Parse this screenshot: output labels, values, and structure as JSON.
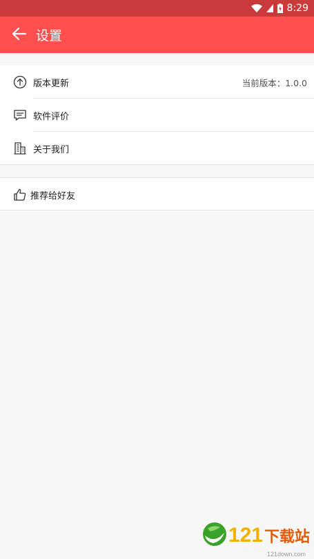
{
  "status_bar": {
    "time": "8:29",
    "icons": [
      "wifi-icon",
      "signal-icon",
      "battery-charging-icon"
    ]
  },
  "app_bar": {
    "title": "设置",
    "back_icon": "arrow-left-icon"
  },
  "settings_group_1": [
    {
      "icon": "upload-circle-icon",
      "label": "版本更新",
      "value": "当前版本：1.0.0"
    },
    {
      "icon": "comment-icon",
      "label": "软件评价"
    },
    {
      "icon": "building-icon",
      "label": "关于我们"
    }
  ],
  "settings_group_2": [
    {
      "icon": "thumbs-up-icon",
      "label": "推荐给好友"
    }
  ],
  "watermark": {
    "number": "121",
    "text": "下载站",
    "url": "121down.com"
  },
  "colors": {
    "app_bar": "#ff4f4f",
    "status_bar": "#c93b3b",
    "background": "#f7f7f7",
    "row": "#ffffff"
  }
}
